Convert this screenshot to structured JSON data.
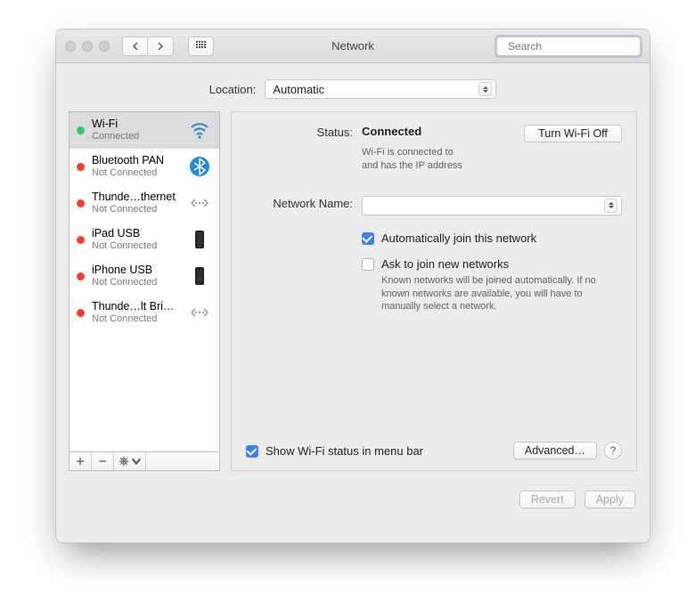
{
  "window": {
    "title": "Network"
  },
  "toolbar": {
    "search_placeholder": "Search"
  },
  "location": {
    "label": "Location:",
    "value": "Automatic"
  },
  "services": [
    {
      "name": "Wi-Fi",
      "status": "Connected",
      "dot": "green",
      "icon": "wifi",
      "selected": true
    },
    {
      "name": "Bluetooth PAN",
      "status": "Not Connected",
      "dot": "red",
      "icon": "bluetooth",
      "selected": false
    },
    {
      "name": "Thunde…thernet",
      "status": "Not Connected",
      "dot": "red",
      "icon": "thunderbolt",
      "selected": false
    },
    {
      "name": "iPad USB",
      "status": "Not Connected",
      "dot": "red",
      "icon": "device",
      "selected": false
    },
    {
      "name": "iPhone USB",
      "status": "Not Connected",
      "dot": "red",
      "icon": "device",
      "selected": false
    },
    {
      "name": "Thunde…lt Bridge",
      "status": "Not Connected",
      "dot": "red",
      "icon": "thunderbolt",
      "selected": false
    }
  ],
  "detail": {
    "status_label": "Status:",
    "status_value": "Connected",
    "turnoff_label": "Turn Wi-Fi Off",
    "status_desc_line1": "Wi-Fi is connected to",
    "status_desc_line2": "and has the IP address",
    "network_name_label": "Network Name:",
    "network_name_value": "",
    "auto_join_label": "Automatically join this network",
    "auto_join_checked": true,
    "ask_join_label": "Ask to join new networks",
    "ask_join_checked": false,
    "ask_join_desc": "Known networks will be joined automatically. If no known networks are available, you will have to manually select a network.",
    "show_menu_label": "Show Wi-Fi status in menu bar",
    "show_menu_checked": true,
    "advanced_label": "Advanced…",
    "help_label": "?"
  },
  "footer": {
    "revert_label": "Revert",
    "apply_label": "Apply"
  }
}
